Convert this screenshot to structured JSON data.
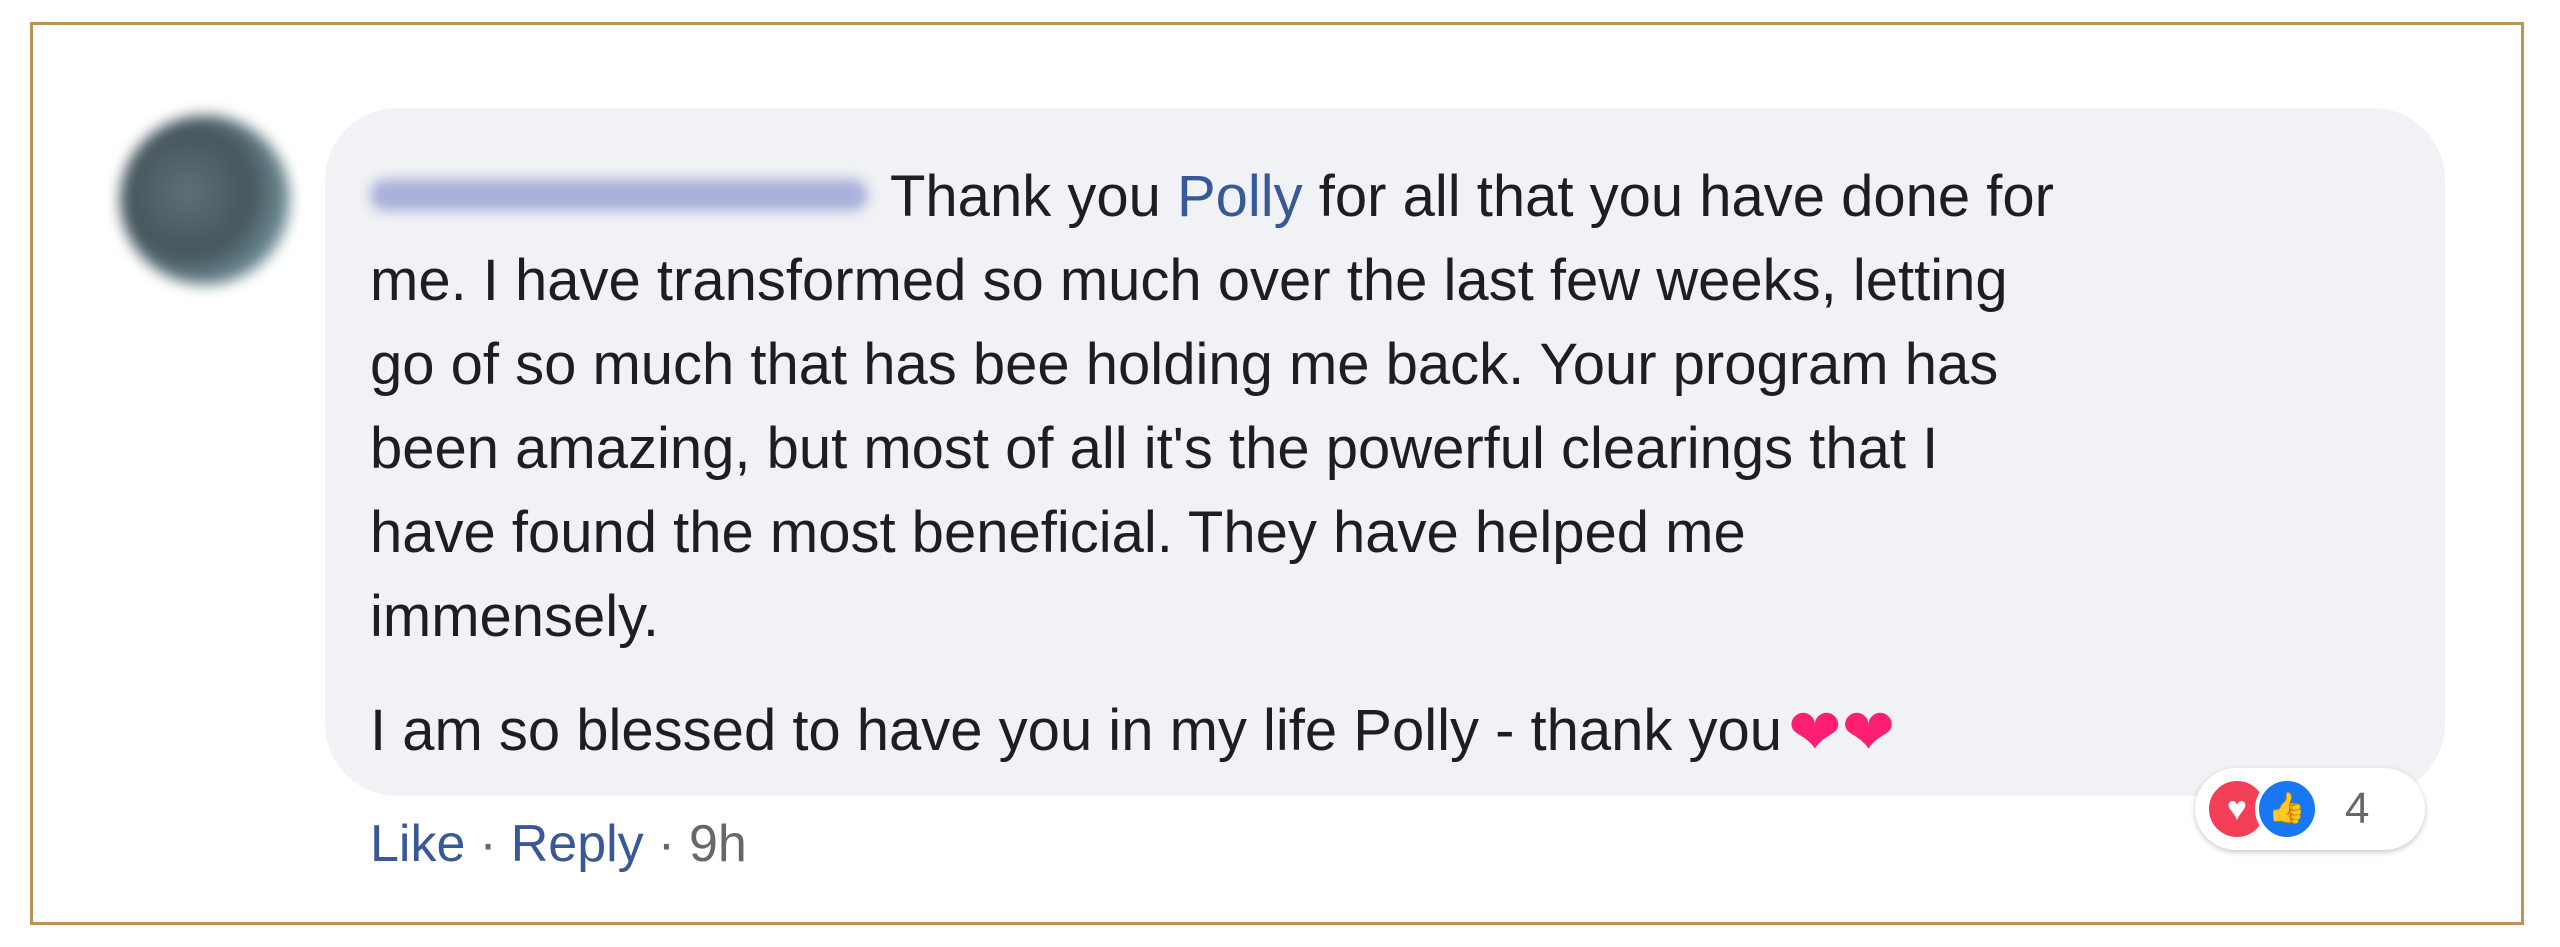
{
  "comment": {
    "line1_pre": "Thank you ",
    "mention": "Polly",
    "line1_post": " for all that you have done for",
    "paragraph1_rest": "me. I have transformed so much over the last few weeks, letting\ngo of so much that has bee holding me back. Your program has\nbeen amazing, but most of all it's the powerful clearings that I\nhave found the most beneficial. They have helped me\nimmensely.",
    "paragraph2": "I am so blessed to have you in my life Polly - thank you",
    "hearts": "❤❤"
  },
  "reactions": {
    "love_icon": "♥",
    "like_icon": "👍",
    "count": "4"
  },
  "actions": {
    "like": "Like",
    "separator": "·",
    "reply": "Reply",
    "time": "9h"
  },
  "colors": {
    "bubble": "#f0f2f5",
    "link": "#385898",
    "frame": "#b8945a",
    "heart": "#ff1f72"
  }
}
